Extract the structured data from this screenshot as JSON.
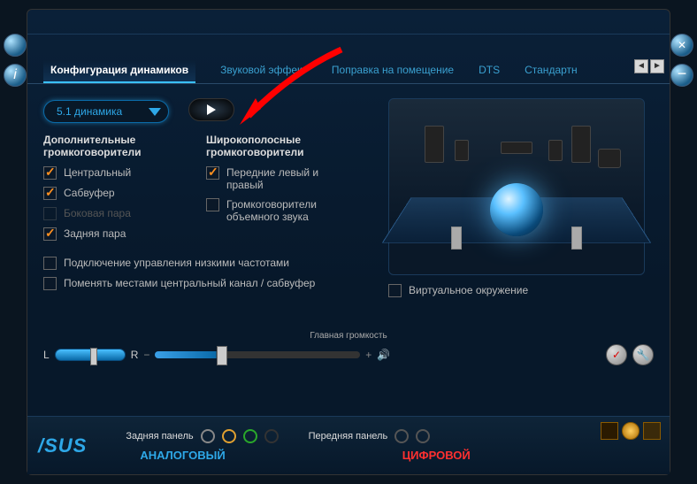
{
  "tabs": {
    "t0": "Конфигурация динамиков",
    "t1": "Звуковой эффект",
    "t2": "Поправка на помещение",
    "t3": "DTS",
    "t4": "Стандартн"
  },
  "dropdown": {
    "value": "5.1 динамика"
  },
  "cols": {
    "extra_head": "Дополнительные громкоговорители",
    "wide_head": "Широкополосные громкоговорители",
    "center": "Центральный",
    "sub": "Сабвуфер",
    "side": "Боковая пара",
    "rear": "Задняя пара",
    "front": "Передние левый и правый",
    "surround": "Громкоговорители объемного звука"
  },
  "opts": {
    "bass": "Подключение управления низкими частотами",
    "swap": "Поменять местами центральный канал / сабвуфер",
    "virtual": "Виртуальное окружение"
  },
  "volume": {
    "label": "Главная громкость",
    "L": "L",
    "R": "R",
    "minus": "−",
    "plus": "+"
  },
  "bottom": {
    "logo": "/SUS",
    "rear": "Задняя панель",
    "front": "Передняя панель",
    "analog": "АНАЛОГОВЫЙ",
    "digital": "ЦИФРОВОЙ"
  }
}
